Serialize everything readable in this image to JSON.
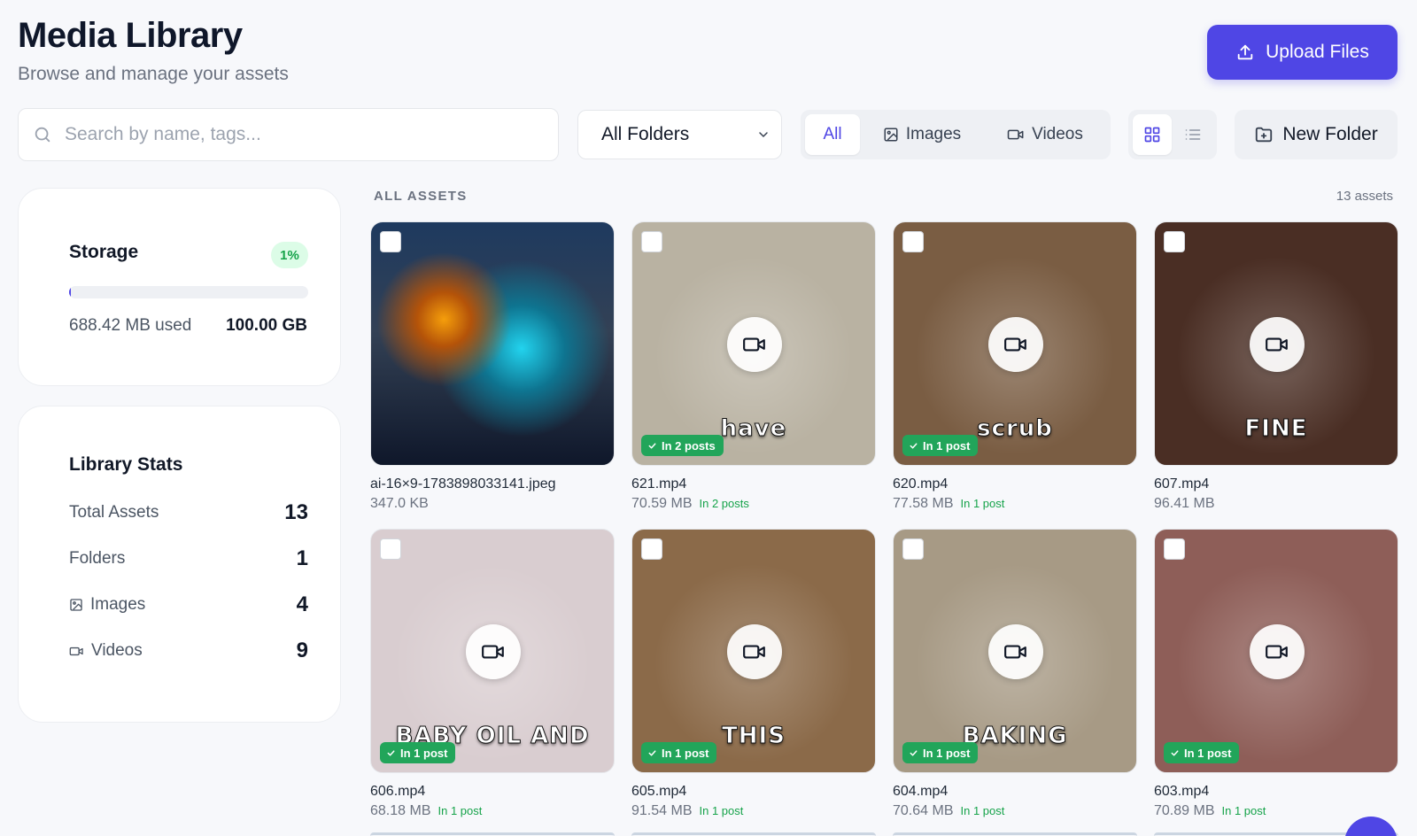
{
  "header": {
    "title": "Media Library",
    "subtitle": "Browse and manage your assets",
    "upload_label": "Upload Files"
  },
  "toolbar": {
    "search_placeholder": "Search by name, tags...",
    "folder_selected": "All Folders",
    "filters": [
      "All",
      "Images",
      "Videos"
    ],
    "active_filter": "All",
    "view_mode": "grid",
    "new_folder_label": "New Folder"
  },
  "storage": {
    "title": "Storage",
    "percent_label": "1%",
    "percent_value": 0.0069,
    "used": "688.42 MB used",
    "total": "100.00 GB"
  },
  "stats": {
    "title": "Library Stats",
    "rows": [
      {
        "label": "Total Assets",
        "value": "13"
      },
      {
        "label": "Folders",
        "value": "1"
      },
      {
        "label": "Images",
        "value": "4",
        "icon": "image-icon"
      },
      {
        "label": "Videos",
        "value": "9",
        "icon": "video-icon"
      }
    ]
  },
  "grid": {
    "section_label": "ALL ASSETS",
    "count_label": "13 assets",
    "assets": [
      {
        "name": "ai-16×9-1783898033141.jpeg",
        "size": "347.0 KB",
        "type": "image",
        "posts": "",
        "caption": "",
        "bg": "#1b3a4b"
      },
      {
        "name": "621.mp4",
        "size": "70.59 MB",
        "type": "video",
        "posts": "In 2 posts",
        "caption": "have",
        "bg": "#b9b2a2"
      },
      {
        "name": "620.mp4",
        "size": "77.58 MB",
        "type": "video",
        "posts": "In 1 post",
        "caption": "scrub",
        "bg": "#7a5d43"
      },
      {
        "name": "607.mp4",
        "size": "96.41 MB",
        "type": "video",
        "posts": "",
        "caption": "FINE",
        "bg": "#4a2e24"
      },
      {
        "name": "606.mp4",
        "size": "68.18 MB",
        "type": "video",
        "posts": "In 1 post",
        "caption": "BABY OIL AND",
        "bg": "#d9cdd0"
      },
      {
        "name": "605.mp4",
        "size": "91.54 MB",
        "type": "video",
        "posts": "In 1 post",
        "caption": "THIS",
        "bg": "#8b6a49"
      },
      {
        "name": "604.mp4",
        "size": "70.64 MB",
        "type": "video",
        "posts": "In 1 post",
        "caption": "BAKING",
        "bg": "#a79a85"
      },
      {
        "name": "603.mp4",
        "size": "70.89 MB",
        "type": "video",
        "posts": "In 1 post",
        "caption": "",
        "bg": "#8e5e58"
      }
    ]
  },
  "colors": {
    "accent": "#4f46e5",
    "success": "#22a55a"
  }
}
